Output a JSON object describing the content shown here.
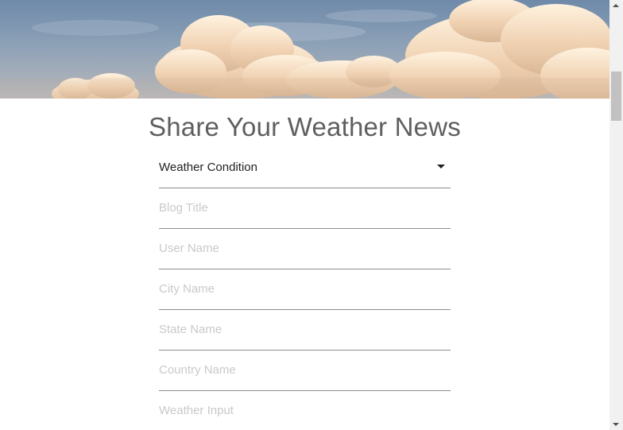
{
  "page": {
    "title": "Share Your Weather News"
  },
  "form": {
    "weather_condition": {
      "value": "Weather Condition"
    },
    "fields": [
      {
        "placeholder": "Blog Title"
      },
      {
        "placeholder": "User Name"
      },
      {
        "placeholder": "City Name"
      },
      {
        "placeholder": "State Name"
      },
      {
        "placeholder": "Country Name"
      },
      {
        "placeholder": "Weather Input"
      }
    ]
  },
  "colors": {
    "title": "#5f5f5f",
    "placeholder": "#c9c9c9",
    "underline": "#8d8d8d",
    "sky": "#7f98b2",
    "cloud": "#f2d6b3"
  }
}
